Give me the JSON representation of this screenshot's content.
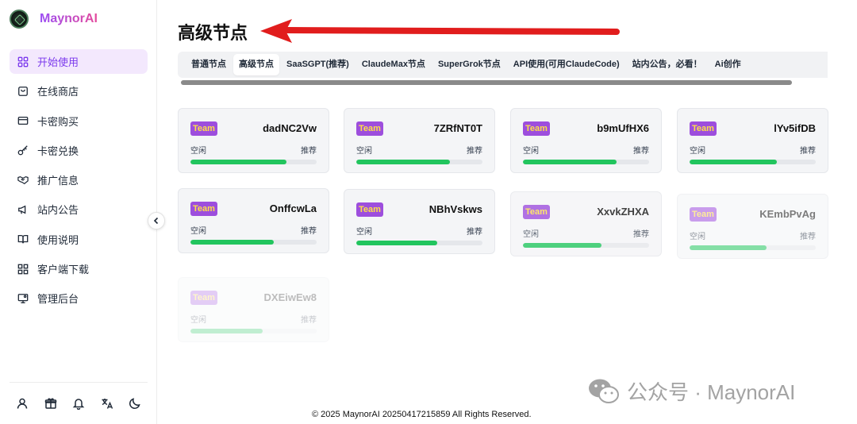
{
  "brand": {
    "name": "MaynorAI"
  },
  "sidebar": {
    "items": [
      {
        "label": "开始使用",
        "icon": "grid-icon",
        "active": true
      },
      {
        "label": "在线商店",
        "icon": "shopping-bag-icon",
        "active": false
      },
      {
        "label": "卡密购买",
        "icon": "credit-card-icon",
        "active": false
      },
      {
        "label": "卡密兑换",
        "icon": "key-icon",
        "active": false
      },
      {
        "label": "推广信息",
        "icon": "handshake-icon",
        "active": false
      },
      {
        "label": "站内公告",
        "icon": "megaphone-icon",
        "active": false
      },
      {
        "label": "使用说明",
        "icon": "book-icon",
        "active": false
      },
      {
        "label": "客户端下载",
        "icon": "apps-icon",
        "active": false
      },
      {
        "label": "管理后台",
        "icon": "monitor-settings-icon",
        "active": false
      }
    ],
    "footer_icons": [
      "user-icon",
      "gift-icon",
      "bell-icon",
      "translate-icon",
      "moon-icon"
    ]
  },
  "main": {
    "title": "高级节点",
    "tabs": [
      {
        "label": "普通节点",
        "active": false
      },
      {
        "label": "高级节点",
        "active": true
      },
      {
        "label": "SaaSGPT(推荐)",
        "active": false
      },
      {
        "label": "ClaudeMax节点",
        "active": false
      },
      {
        "label": "SuperGrok节点",
        "active": false
      },
      {
        "label": "API使用(可用ClaudeCode)",
        "active": false
      },
      {
        "label": "站内公告，必看！",
        "active": false
      },
      {
        "label": "Ai创作",
        "active": false
      }
    ],
    "nodes": [
      {
        "badge": "Team",
        "code": "dadNC2Vw",
        "status": "空闲",
        "tag": "推荐",
        "usage": 0.76,
        "opacity": 1
      },
      {
        "badge": "Team",
        "code": "7ZRfNT0T",
        "status": "空闲",
        "tag": "推荐",
        "usage": 0.74,
        "opacity": 1
      },
      {
        "badge": "Team",
        "code": "b9mUfHX6",
        "status": "空闲",
        "tag": "推荐",
        "usage": 0.74,
        "opacity": 1
      },
      {
        "badge": "Team",
        "code": "lYv5ifDB",
        "status": "空闲",
        "tag": "推荐",
        "usage": 0.69,
        "opacity": 1
      },
      {
        "badge": "Team",
        "code": "OnffcwLa",
        "status": "空闲",
        "tag": "推荐",
        "usage": 0.66,
        "opacity": 1
      },
      {
        "badge": "Team",
        "code": "NBhVskws",
        "status": "空闲",
        "tag": "推荐",
        "usage": 0.64,
        "opacity": 1
      },
      {
        "badge": "Team",
        "code": "XxvkZHXA",
        "status": "空闲",
        "tag": "推荐",
        "usage": 0.62,
        "opacity": 0.8
      },
      {
        "badge": "Team",
        "code": "KEmbPvAg",
        "status": "空闲",
        "tag": "推荐",
        "usage": 0.61,
        "opacity": 0.55
      },
      {
        "badge": "Team",
        "code": "DXEiwEw8",
        "status": "空闲",
        "tag": "推荐",
        "usage": 0.57,
        "opacity": 0.28
      }
    ]
  },
  "footer": {
    "copyright": "© 2025 MaynorAI 20250417215859 All Rights Reserved."
  },
  "watermark": {
    "text": "公众号 · MaynorAI"
  },
  "colors": {
    "accent": "#7c3aed",
    "badge_bg": "#9d4edd",
    "badge_text": "#fde047",
    "progress": "#22c55e",
    "arrow": "#e11d1d"
  }
}
